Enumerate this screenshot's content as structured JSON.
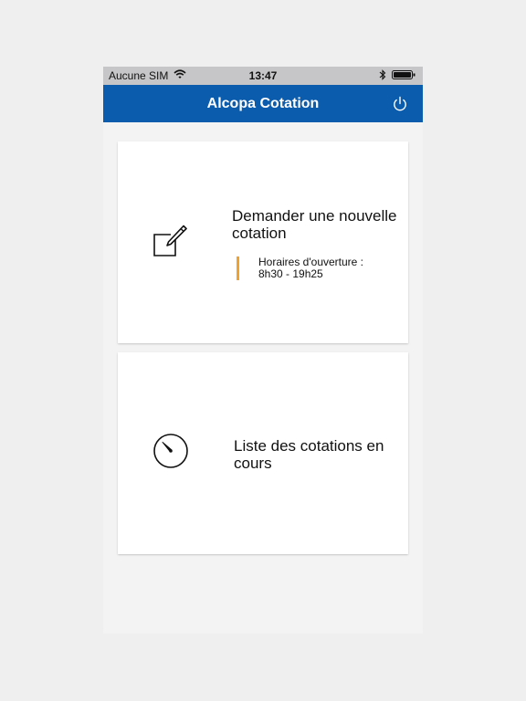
{
  "status_bar": {
    "carrier": "Aucune SIM",
    "time": "13:47",
    "icons": [
      "wifi-icon",
      "bluetooth-icon",
      "battery-icon"
    ]
  },
  "nav": {
    "title": "Alcopa Cotation",
    "right_icon": "power-icon",
    "color": "#0b5cad"
  },
  "cards": [
    {
      "icon": "edit-icon",
      "title": "Demander une nouvelle cotation",
      "hours_label": "Horaires d'ouverture :",
      "hours_value": "8h30 - 19h25",
      "accent": "#f0a22c"
    },
    {
      "icon": "timer-icon",
      "title": "Liste des cotations en cours"
    }
  ]
}
